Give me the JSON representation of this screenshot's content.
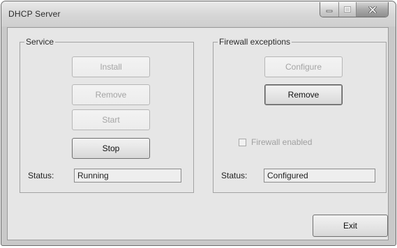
{
  "window": {
    "title": "DHCP Server",
    "icons": {
      "minimize": "minimize-icon",
      "maximize": "maximize-icon",
      "close": "close-icon"
    }
  },
  "service": {
    "label": "Service",
    "install_label": "Install",
    "remove_label": "Remove",
    "start_label": "Start",
    "stop_label": "Stop",
    "status_label": "Status:",
    "status_value": "Running"
  },
  "firewall": {
    "label": "Firewall exceptions",
    "configure_label": "Configure",
    "remove_label": "Remove",
    "enabled_label": "Firewall enabled",
    "enabled_checked": false,
    "status_label": "Status:",
    "status_value": "Configured"
  },
  "exit_label": "Exit",
  "colors": {
    "frame": "#c9c9c9",
    "client": "#e6e6e6",
    "disabled_text": "#a4a4a4"
  }
}
